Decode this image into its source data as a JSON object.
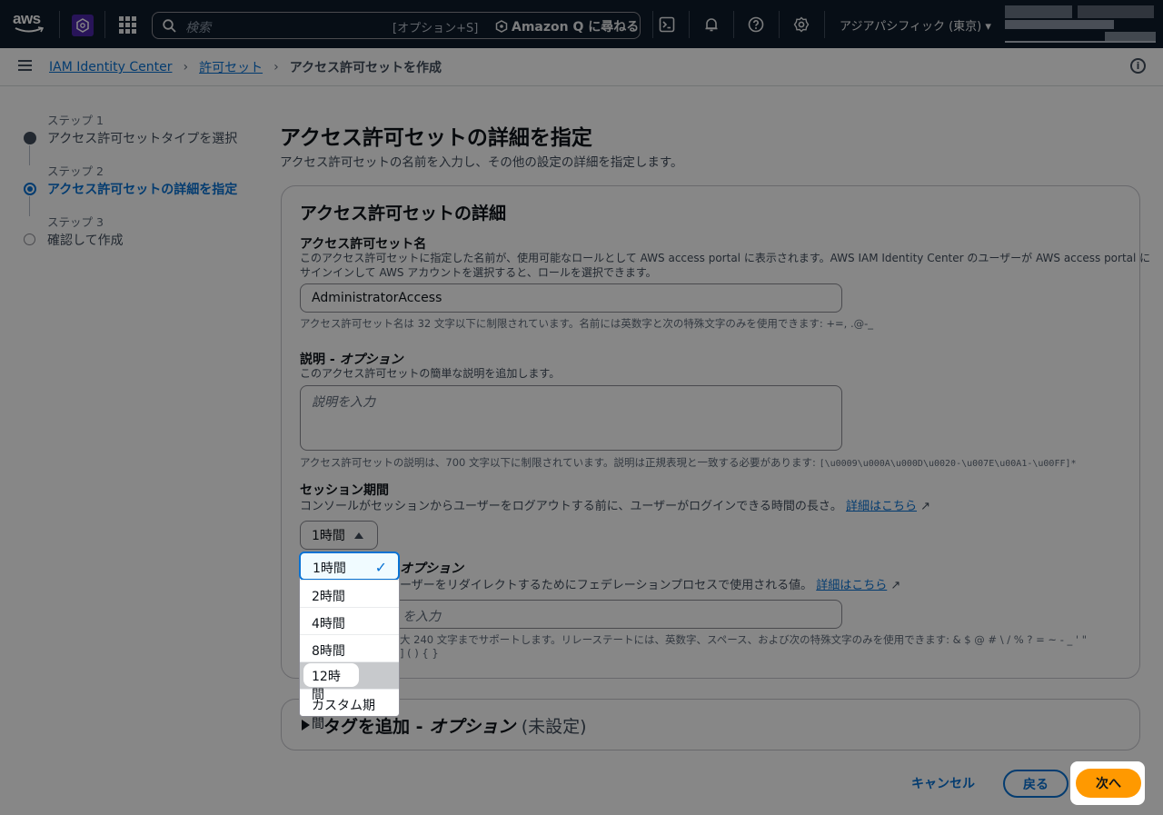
{
  "topnav": {
    "logo": "aws",
    "search_placeholder": "検索",
    "search_shortcut": "[オプション+S]",
    "amazon_q": "Amazon Q に尋ねる",
    "region": "アジアパシフィック (東京) ▾",
    "icons": [
      "cloudshell-icon",
      "bell-icon",
      "help-icon",
      "settings-icon"
    ]
  },
  "breadcrumb": {
    "items": [
      "IAM Identity Center",
      "許可セット"
    ],
    "current": "アクセス許可セットを作成"
  },
  "steps": [
    {
      "num": "ステップ 1",
      "label": "アクセス許可セットタイプを選択",
      "state": "done"
    },
    {
      "num": "ステップ 2",
      "label": "アクセス許可セットの詳細を指定",
      "state": "active"
    },
    {
      "num": "ステップ 3",
      "label": "確認して作成",
      "state": "todo"
    }
  ],
  "main": {
    "title": "アクセス許可セットの詳細を指定",
    "description": "アクセス許可セットの名前を入力し、その他の設定の詳細を指定します。"
  },
  "details": {
    "heading": "アクセス許可セットの詳細",
    "name": {
      "label": "アクセス許可セット名",
      "desc_line1": "このアクセス許可セットに指定した名前が、使用可能なロールとして AWS access portal に表示されます。AWS IAM Identity Center のユーザーが AWS access portal に",
      "desc_line2": "サインインして AWS アカウントを選択すると、ロールを選択できます。",
      "value": "AdministratorAccess",
      "hint": "アクセス許可セット名は 32 文字以下に制限されています。名前には英数字と次の特殊文字のみを使用できます: +=, .@-_"
    },
    "description": {
      "label": "説明 - ",
      "label_opt": "オプション",
      "desc": "このアクセス許可セットの簡単な説明を追加します。",
      "placeholder": "説明を入力",
      "hint": "アクセス許可セットの説明は、700 文字以下に制限されています。説明は正規表現と一致する必要があります: ",
      "regex": "[\\u0009\\u000A\\u000D\\u0020-\\u007E\\u00A1-\\u00FF]*"
    },
    "session": {
      "label": "セッション期間",
      "desc": "コンソールがセッションからユーザーをログアウトする前に、ユーザーがログインできる時間の長さ。",
      "link": "詳細はこちら",
      "selected": "1時間"
    },
    "relay": {
      "label_partial": "オプション",
      "desc_partial": "ーザーをリダイレクトするためにフェデレーションプロセスで使用される値。",
      "link": "詳細はこちら",
      "placeholder_partial": "を入力",
      "hint_partial": "大 240 文字までサポートします。リレーステートには、英数字、スペース、および次の特殊文字のみを使用できます: & $ @ # \\ / % ? = ~ - _ ' \"",
      "hint_partial2": "] ( ) { }"
    }
  },
  "tags": {
    "label": "タグを追加 - ",
    "label_opt": "オプション",
    "status": "(未設定)"
  },
  "dropdown": {
    "options": [
      "1時間",
      "2時間",
      "4時間",
      "8時間",
      "12時間",
      "カスタム期間"
    ],
    "selected_index": 0,
    "highlight_index": 4
  },
  "actions": {
    "cancel": "キャンセル",
    "back": "戻る",
    "next": "次へ"
  },
  "colors": {
    "accent": "#0972d3",
    "primary_button": "#ff9900",
    "nav_bg": "#0f1b2a"
  }
}
